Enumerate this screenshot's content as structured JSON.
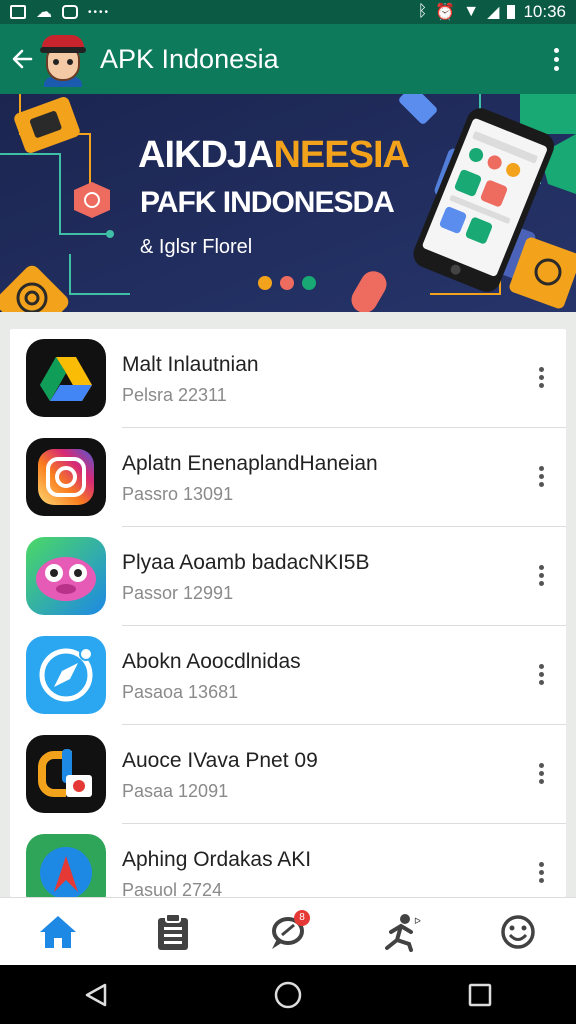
{
  "statusbar": {
    "time": "10:36",
    "icons": [
      "image-icon",
      "cloud-icon",
      "gallery-icon",
      "dots-icon",
      "bluetooth-icon",
      "alarm-icon",
      "wifi-icon",
      "signal-icon",
      "battery-icon"
    ]
  },
  "appbar": {
    "title": "APK Indonesia",
    "back_icon": "back-arrow-icon",
    "menu_icon": "overflow-menu-icon"
  },
  "banner": {
    "title_white": "AIKDJA",
    "title_orange": "NEESIA",
    "subtitle": "PAFK INDONESDA",
    "tagline": "& Iglsr Florel",
    "dot_colors": [
      "#f3a21b",
      "#ee6b5f",
      "#19a974"
    ]
  },
  "apps": [
    {
      "name": "Malt Inlautnian",
      "package": "Pelsra 22311",
      "icon": "drive-icon"
    },
    {
      "name": "Aplatn EnenaplandHaneian",
      "package": "Passro 13091",
      "icon": "instagram-icon"
    },
    {
      "name": "Plyaa Aoamb badacNKI5B",
      "package": "Passor 12991",
      "icon": "pink-creature-icon"
    },
    {
      "name": "Abokn Aoocdlnidas",
      "package": "Pasaoa 13681",
      "icon": "compass-icon"
    },
    {
      "name": "Auoce IVava Pnet 09",
      "package": "Pasaa 12091",
      "icon": "colorful-g-icon"
    },
    {
      "name": "Aphing Ordakas AKI",
      "package": "Pasuol 2724",
      "icon": "red-a-icon"
    }
  ],
  "bottomnav": {
    "items": [
      "home-icon",
      "clipboard-icon",
      "chat-icon",
      "runner-icon",
      "smiley-icon"
    ],
    "badge": "8",
    "active_color": "#1e88e5"
  },
  "sysnav": [
    "back-triangle-icon",
    "home-circle-icon",
    "recents-square-icon"
  ]
}
